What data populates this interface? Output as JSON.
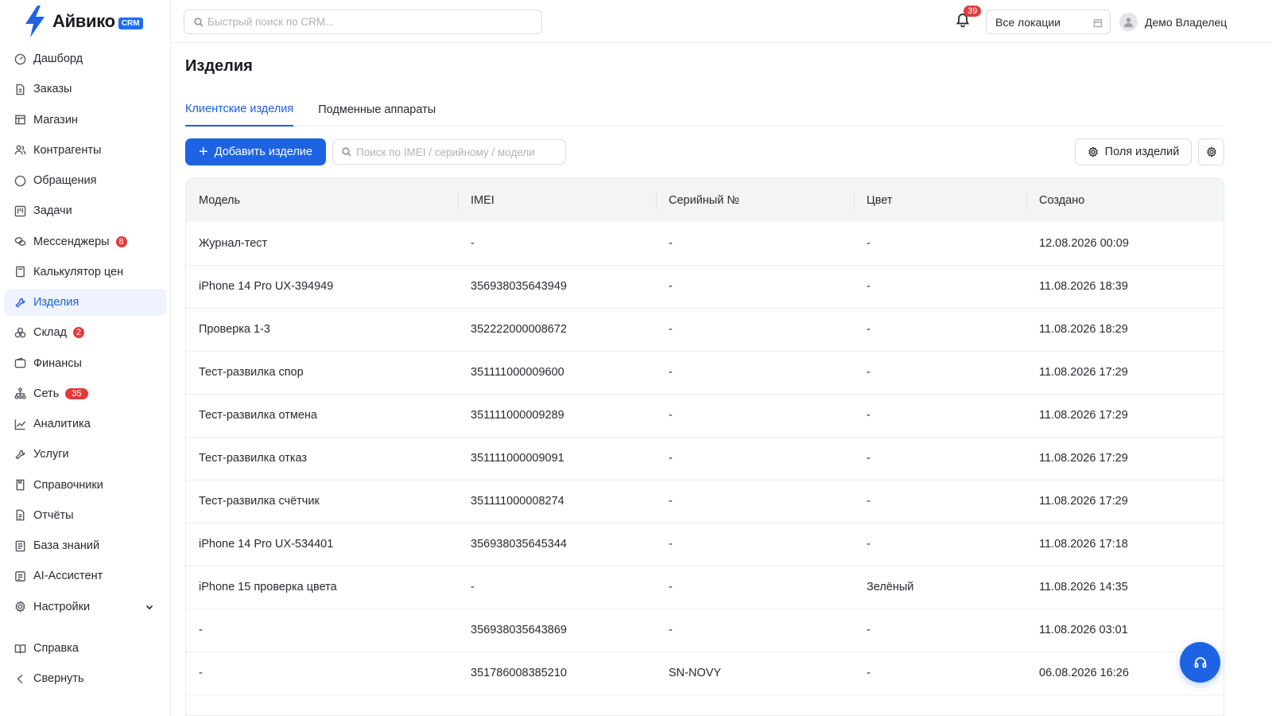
{
  "app": {
    "logo_text": "Айвико",
    "logo_badge": "CRM",
    "accent_color": "#1d63e4"
  },
  "sidebar": {
    "items": [
      {
        "label": "Дашборд",
        "icon": "dashboard-icon"
      },
      {
        "label": "Заказы",
        "icon": "document-icon"
      },
      {
        "label": "Магазин",
        "icon": "store-icon"
      },
      {
        "label": "Контрагенты",
        "icon": "users-icon"
      },
      {
        "label": "Обращения",
        "icon": "chat-icon"
      },
      {
        "label": "Задачи",
        "icon": "kanban-icon"
      },
      {
        "label": "Мессенджеры",
        "icon": "messengers-icon",
        "badge": "8"
      },
      {
        "label": "Калькулятор цен",
        "icon": "calculator-icon"
      },
      {
        "label": "Изделия",
        "icon": "wrench-icon",
        "active": true
      },
      {
        "label": "Склад",
        "icon": "boxes-icon",
        "badge": "2"
      },
      {
        "label": "Финансы",
        "icon": "wallet-icon"
      },
      {
        "label": "Сеть",
        "icon": "network-icon",
        "badge": "35"
      },
      {
        "label": "Аналитика",
        "icon": "chart-line-icon"
      },
      {
        "label": "Услуги",
        "icon": "tools-icon"
      },
      {
        "label": "Справочники",
        "icon": "book-icon"
      },
      {
        "label": "Отчёты",
        "icon": "report-icon"
      },
      {
        "label": "База знаний",
        "icon": "knowledge-icon"
      },
      {
        "label": "AI-Ассистент",
        "icon": "ai-icon"
      },
      {
        "label": "Настройки",
        "icon": "gear-icon",
        "expandable": true
      }
    ],
    "bottom": [
      {
        "label": "Справка",
        "icon": "open-book-icon"
      },
      {
        "label": "Свернуть",
        "icon": "chevron-left-icon"
      }
    ]
  },
  "topbar": {
    "search_placeholder": "Быстрый поиск по CRM...",
    "notifications_count": "39",
    "location_select": "Все локации",
    "user_name": "Демо Владелец"
  },
  "page": {
    "title": "Изделия",
    "tabs": [
      {
        "label": "Клиентские изделия",
        "active": true
      },
      {
        "label": "Подменные аппараты",
        "active": false
      }
    ],
    "add_button": "Добавить изделие",
    "table_search_placeholder": "Поиск по IMEI / серийному / модели",
    "fields_button": "Поля изделий"
  },
  "table": {
    "columns": [
      "Модель",
      "IMEI",
      "Серийный №",
      "Цвет",
      "Создано"
    ],
    "rows": [
      [
        "Журнал-тест",
        "-",
        "-",
        "-",
        "12.08.2026 00:09"
      ],
      [
        "iPhone 14 Pro UX-394949",
        "356938035643949",
        "-",
        "-",
        "11.08.2026 18:39"
      ],
      [
        "Проверка 1-3",
        "352222000008672",
        "-",
        "-",
        "11.08.2026 18:29"
      ],
      [
        "Тест-развилка спор",
        "351111000009600",
        "-",
        "-",
        "11.08.2026 17:29"
      ],
      [
        "Тест-развилка отмена",
        "351111000009289",
        "-",
        "-",
        "11.08.2026 17:29"
      ],
      [
        "Тест-развилка отказ",
        "351111000009091",
        "-",
        "-",
        "11.08.2026 17:29"
      ],
      [
        "Тест-развилка счётчик",
        "351111000008274",
        "-",
        "-",
        "11.08.2026 17:29"
      ],
      [
        "iPhone 14 Pro UX-534401",
        "356938035645344",
        "-",
        "-",
        "11.08.2026 17:18"
      ],
      [
        "iPhone 15 проверка цвета",
        "-",
        "-",
        "Зелёный",
        "11.08.2026 14:35"
      ],
      [
        "-",
        "356938035643869",
        "-",
        "-",
        "11.08.2026 03:01"
      ],
      [
        "-",
        "351786008385210",
        "SN-NOVY",
        "-",
        "06.08.2026 16:26"
      ]
    ]
  }
}
